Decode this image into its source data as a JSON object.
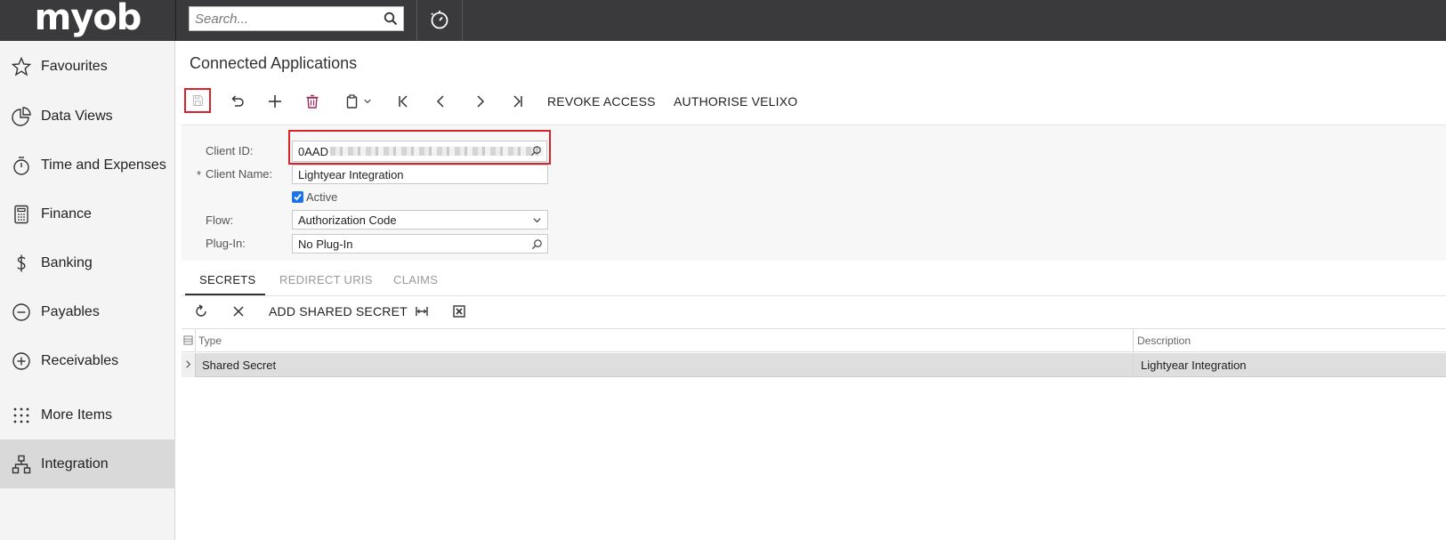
{
  "app": {
    "logo_text": "myob"
  },
  "topbar": {
    "search_placeholder": "Search..."
  },
  "sidebar": {
    "items": [
      {
        "label": "Favourites",
        "icon": "star-icon"
      },
      {
        "label": "Data Views",
        "icon": "pie-chart-icon"
      },
      {
        "label": "Time and Expenses",
        "icon": "stopwatch-icon"
      },
      {
        "label": "Finance",
        "icon": "calculator-icon"
      },
      {
        "label": "Banking",
        "icon": "dollar-icon"
      },
      {
        "label": "Payables",
        "icon": "minus-circle-icon"
      },
      {
        "label": "Receivables",
        "icon": "plus-circle-icon"
      },
      {
        "label": "More Items",
        "icon": "grid-dots-icon"
      },
      {
        "label": "Integration",
        "icon": "hierarchy-icon",
        "active": true
      }
    ]
  },
  "page": {
    "title": "Connected Applications"
  },
  "toolbar": {
    "revoke_label": "REVOKE ACCESS",
    "authorise_label": "AUTHORISE VELIXO"
  },
  "form": {
    "client_id_label": "Client ID:",
    "client_id_value": "0AAD",
    "client_name_required": "*",
    "client_name_label": "Client Name:",
    "client_name_value": "Lightyear Integration",
    "active_label": "Active",
    "active_checked": true,
    "flow_label": "Flow:",
    "flow_value": "Authorization Code",
    "plugin_label": "Plug-In:",
    "plugin_value": "No Plug-In"
  },
  "tabs": [
    {
      "label": "SECRETS",
      "active": true
    },
    {
      "label": "REDIRECT URIS",
      "active": false
    },
    {
      "label": "CLAIMS",
      "active": false
    }
  ],
  "grid_toolbar": {
    "add_label": "ADD SHARED SECRET"
  },
  "table": {
    "columns": [
      "Type",
      "Description"
    ],
    "rows": [
      {
        "type": "Shared Secret",
        "description": "Lightyear Integration"
      }
    ]
  },
  "colors": {
    "accent_red": "#d9232a",
    "topbar": "#3a3a3c",
    "checkbox_blue": "#1a73e8"
  }
}
